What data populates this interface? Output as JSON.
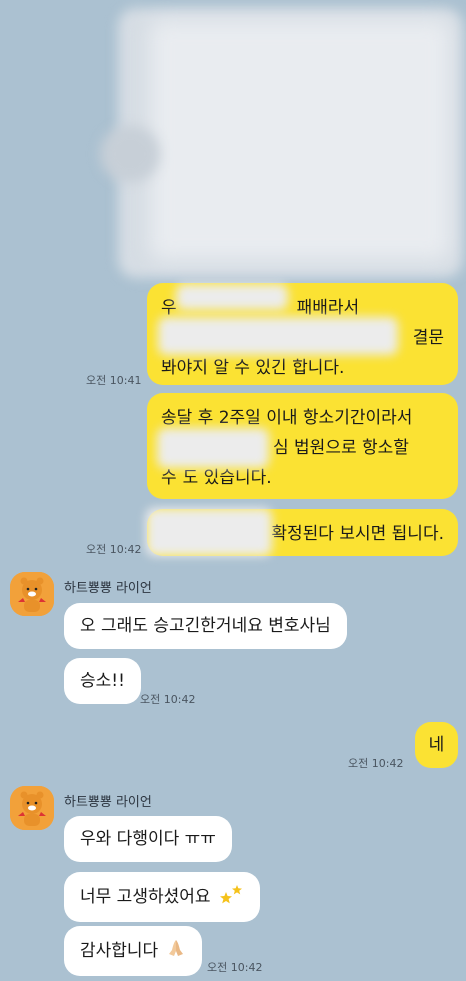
{
  "messages": {
    "m1": {
      "line1_prefix": "우",
      "line1_suffix": "패배라서",
      "line2_suffix": "결문",
      "line3": "봐야지 알 수 있긴 합니다.",
      "time": "오전 10:41"
    },
    "m2": {
      "line1": "송달 후 2주일 이내 항소기간이라서",
      "line2_suffix": "심 법원으로 항소할",
      "line3_prefix": "수",
      "line3_suffix": "도 있습니다."
    },
    "m3": {
      "suffix": "확정된다 보시면 됩니다.",
      "time": "오전 10:42"
    },
    "group1": {
      "sender": "하트뿅뿅 라이언",
      "msg1": "오 그래도 승고긴한거네요 변호사님",
      "msg2": "승소!!",
      "time": "오전 10:42"
    },
    "m4": {
      "text": "네",
      "time": "오전 10:42"
    },
    "group2": {
      "sender": "하트뿅뿅 라이언",
      "msg1": "우와 다행이다 ㅠㅠ",
      "msg2": "너무 고생하셨어요",
      "msg3": "감사합니다",
      "time": "오전 10:42"
    }
  },
  "colors": {
    "background": "#abc1d1",
    "my_bubble": "#fbe233",
    "their_bubble": "#ffffff",
    "avatar": "#f2a13a"
  },
  "icons": [
    "ryan-avatar-icon",
    "sparkle-stars-icon",
    "praying-hands-icon"
  ]
}
